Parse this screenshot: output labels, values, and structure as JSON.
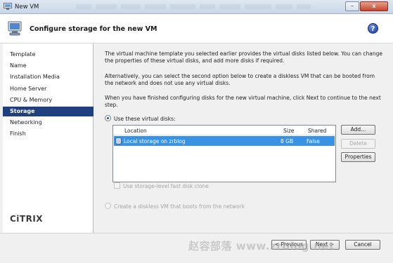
{
  "window": {
    "title": "New VM",
    "close_label": "x",
    "minimize_label": "–"
  },
  "header": {
    "title": "Configure storage for the new VM",
    "help_label": "?"
  },
  "sidebar": {
    "items": [
      {
        "label": "Template"
      },
      {
        "label": "Name"
      },
      {
        "label": "Installation Media"
      },
      {
        "label": "Home Server"
      },
      {
        "label": "CPU & Memory"
      },
      {
        "label": "Storage",
        "active": true
      },
      {
        "label": "Networking"
      },
      {
        "label": "Finish"
      }
    ],
    "logo": "CiTRIX"
  },
  "content": {
    "para1": "The virtual machine template you selected earlier provides the virtual disks listed below. You can change the properties of these virtual disks, and add more disks if required.",
    "para2": "Alternatively, you can select the second option below to create a diskless VM that can be booted from the network and does not use any virtual disks.",
    "para3": "When you have finished configuring disks for the new virtual machine, click Next to continue to the next step.",
    "option_use_disks": "Use these virtual disks:",
    "option_diskless": "Create a diskless VM that boots from the network",
    "checkbox_fast_clone": "Use storage-level fast disk clone"
  },
  "disk_table": {
    "columns": [
      "Location",
      "Size",
      "Shared"
    ],
    "rows": [
      {
        "location": "Local storage on zrblog",
        "size": "8 GB",
        "shared": "False",
        "selected": true
      }
    ]
  },
  "buttons": {
    "add": "Add...",
    "delete": "Delete",
    "properties": "Properties",
    "previous": "< Previous",
    "next": "Next >",
    "cancel": "Cancel"
  },
  "watermark": "赵容部落 www.zrblog.net",
  "colors": {
    "selection": "#3a92e4",
    "nav_active": "#1e3f80"
  }
}
